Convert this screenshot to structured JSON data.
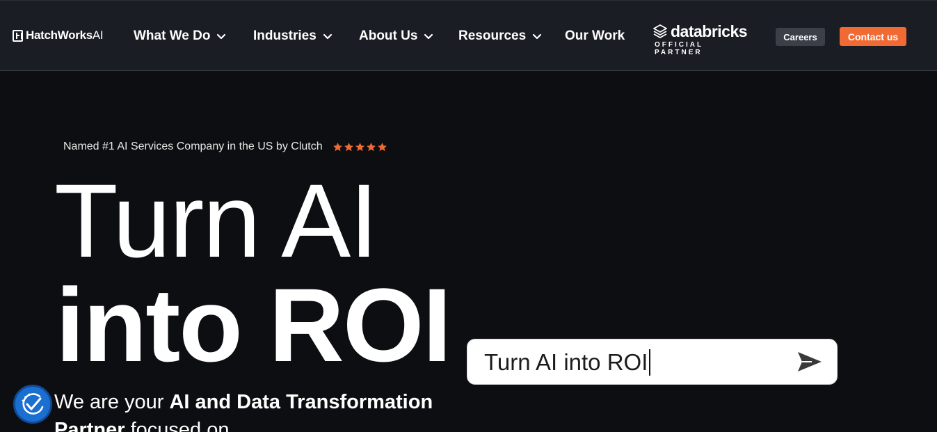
{
  "header": {
    "logo": {
      "brand": "HatchWorks",
      "suffix": "AI"
    },
    "nav": [
      {
        "label": "What We Do",
        "has_dropdown": true
      },
      {
        "label": "Industries",
        "has_dropdown": true
      },
      {
        "label": "About Us",
        "has_dropdown": true
      },
      {
        "label": "Resources",
        "has_dropdown": true
      },
      {
        "label": "Our Work",
        "has_dropdown": false
      }
    ],
    "partner": {
      "name": "databricks",
      "tagline": "OFFICIAL PARTNER"
    },
    "careers_label": "Careers",
    "contact_label": "Contact us"
  },
  "hero": {
    "badge_text": "Named #1 AI Services Company in the US by Clutch",
    "rating": 5,
    "title_line1": "Turn AI",
    "title_line2": "into ROI",
    "subhead_prefix": "We are your ",
    "subhead_bold": "AI and Data Transformation Partner",
    "subhead_suffix": " focused on"
  },
  "chat_input": {
    "value": "Turn AI into ROI"
  },
  "colors": {
    "accent": "#f26a33",
    "header_bg": "#1a1d23",
    "page_bg": "#0d0e11",
    "accessibility_blue": "#1b6fd1"
  }
}
